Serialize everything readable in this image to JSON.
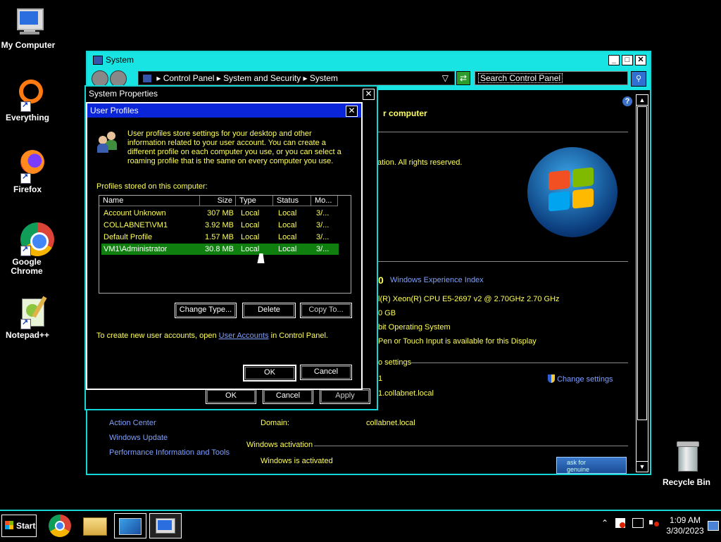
{
  "desktop": {
    "icons": [
      {
        "label": "My Computer"
      },
      {
        "label": "Everything"
      },
      {
        "label": "Firefox"
      },
      {
        "label": "Google Chrome"
      },
      {
        "label": "Notepad++"
      },
      {
        "label": "Recycle Bin"
      }
    ]
  },
  "system_window": {
    "title": "System",
    "breadcrumb": [
      "Control Panel",
      "System and Security",
      "System"
    ],
    "search_placeholder": "Search Control Panel",
    "heading_fragment": "r computer",
    "copyright_fragment": "ation.  All rights reserved.",
    "rating_fragment": "0",
    "experience_index_link": "Windows Experience Index",
    "processor_fragment": "l(R) Xeon(R) CPU E5-2697 v2 @ 2.70GHz   2.70 GHz",
    "memory_fragment": "0 GB",
    "system_type_fragment": "bit Operating System",
    "pen_fragment": "Pen or Touch Input is available for this Display",
    "section_settings_fragment": "o settings",
    "computer_name_fragment": "1",
    "full_name_fragment": "1.collabnet.local",
    "change_settings": "Change settings",
    "domain_label": "Domain:",
    "domain_value": "collabnet.local",
    "activation_header": "Windows activation",
    "activation_status": "Windows is activated",
    "see_also": [
      "Action Center",
      "Windows Update",
      "Performance Information and Tools"
    ],
    "genuine_badge": "ask for genuine"
  },
  "system_properties": {
    "title": "System Properties",
    "buttons": {
      "ok": "OK",
      "cancel": "Cancel",
      "apply": "Apply"
    }
  },
  "user_profiles": {
    "title": "User Profiles",
    "description": "User profiles store settings for your desktop and other information related to your user account. You can create a different profile on each computer you use, or you can select a roaming profile that is the same on every computer you use.",
    "list_label": "Profiles stored on this computer:",
    "columns": [
      "Name",
      "Size",
      "Type",
      "Status",
      "Mo..."
    ],
    "rows": [
      {
        "name": "Account Unknown",
        "size": "307 MB",
        "type": "Local",
        "status": "Local",
        "modified": "3/..."
      },
      {
        "name": "COLLABNET\\VM1",
        "size": "3.92 MB",
        "type": "Local",
        "status": "Local",
        "modified": "3/..."
      },
      {
        "name": "Default Profile",
        "size": "1.57 MB",
        "type": "Local",
        "status": "Local",
        "modified": "3/..."
      },
      {
        "name": "VM1\\Administrator",
        "size": "30.8 MB",
        "type": "Local",
        "status": "Local",
        "modified": "3/...",
        "selected": true
      }
    ],
    "buttons": {
      "change_type": "Change Type...",
      "delete": "Delete",
      "copy_to": "Copy To...",
      "ok": "OK",
      "cancel": "Cancel"
    },
    "footer_prefix": "To create new user accounts, open ",
    "footer_link": "User Accounts",
    "footer_suffix": " in Control Panel."
  },
  "taskbar": {
    "start_label": "Start",
    "time": "1:09 AM",
    "date": "3/30/2023"
  },
  "colors": {
    "accent": "#19e4e4",
    "selection": "#0f7f0f",
    "text_yellow": "#ffff5a",
    "link": "#7fa0ff",
    "title_blue": "#0a24d8"
  }
}
